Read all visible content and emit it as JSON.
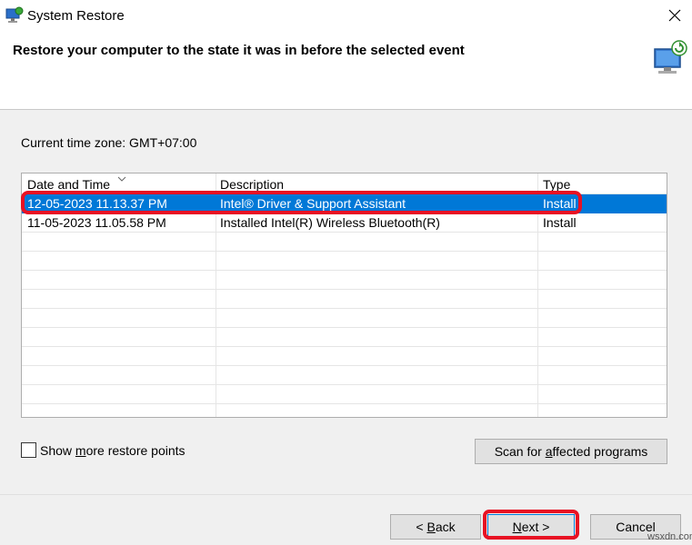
{
  "window": {
    "title": "System Restore",
    "heading": "Restore your computer to the state it was in before the selected event"
  },
  "timezone": "Current time zone: GMT+07:00",
  "table": {
    "columns": [
      "Date and Time",
      "Description",
      "Type"
    ],
    "rows": [
      {
        "date": "12-05-2023 11.13.37 PM",
        "description": "Intel® Driver & Support Assistant",
        "type": "Install",
        "selected": true
      },
      {
        "date": "11-05-2023 11.05.58 PM",
        "description": "Installed Intel(R) Wireless Bluetooth(R)",
        "type": "Install",
        "selected": false
      }
    ]
  },
  "show_more": {
    "pre": "Show ",
    "accel": "m",
    "post": "ore restore points",
    "checked": false
  },
  "scan_button": {
    "pre": "Scan for ",
    "accel": "a",
    "post": "ffected programs"
  },
  "buttons": {
    "back": {
      "pre": "< ",
      "accel": "B",
      "post": "ack"
    },
    "next": {
      "pre": "",
      "accel": "N",
      "post": "ext >"
    },
    "cancel": "Cancel"
  },
  "watermark": "wsxdn.com",
  "colors": {
    "selection": "#0078d7",
    "highlight": "#e81123"
  },
  "icons": [
    "system-restore-icon",
    "close-icon",
    "restore-wizard-icon",
    "sort-arrow-icon"
  ]
}
